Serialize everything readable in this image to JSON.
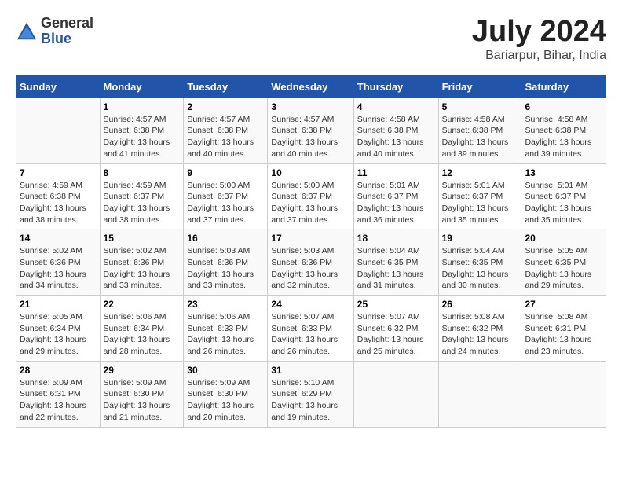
{
  "header": {
    "logo_general": "General",
    "logo_blue": "Blue",
    "title": "July 2024",
    "subtitle": "Bariarpur, Bihar, India"
  },
  "days_of_week": [
    "Sunday",
    "Monday",
    "Tuesday",
    "Wednesday",
    "Thursday",
    "Friday",
    "Saturday"
  ],
  "weeks": [
    [
      {
        "day": "",
        "info": ""
      },
      {
        "day": "1",
        "info": "Sunrise: 4:57 AM\nSunset: 6:38 PM\nDaylight: 13 hours\nand 41 minutes."
      },
      {
        "day": "2",
        "info": "Sunrise: 4:57 AM\nSunset: 6:38 PM\nDaylight: 13 hours\nand 40 minutes."
      },
      {
        "day": "3",
        "info": "Sunrise: 4:57 AM\nSunset: 6:38 PM\nDaylight: 13 hours\nand 40 minutes."
      },
      {
        "day": "4",
        "info": "Sunrise: 4:58 AM\nSunset: 6:38 PM\nDaylight: 13 hours\nand 40 minutes."
      },
      {
        "day": "5",
        "info": "Sunrise: 4:58 AM\nSunset: 6:38 PM\nDaylight: 13 hours\nand 39 minutes."
      },
      {
        "day": "6",
        "info": "Sunrise: 4:58 AM\nSunset: 6:38 PM\nDaylight: 13 hours\nand 39 minutes."
      }
    ],
    [
      {
        "day": "7",
        "info": "Sunrise: 4:59 AM\nSunset: 6:38 PM\nDaylight: 13 hours\nand 38 minutes."
      },
      {
        "day": "8",
        "info": "Sunrise: 4:59 AM\nSunset: 6:37 PM\nDaylight: 13 hours\nand 38 minutes."
      },
      {
        "day": "9",
        "info": "Sunrise: 5:00 AM\nSunset: 6:37 PM\nDaylight: 13 hours\nand 37 minutes."
      },
      {
        "day": "10",
        "info": "Sunrise: 5:00 AM\nSunset: 6:37 PM\nDaylight: 13 hours\nand 37 minutes."
      },
      {
        "day": "11",
        "info": "Sunrise: 5:01 AM\nSunset: 6:37 PM\nDaylight: 13 hours\nand 36 minutes."
      },
      {
        "day": "12",
        "info": "Sunrise: 5:01 AM\nSunset: 6:37 PM\nDaylight: 13 hours\nand 35 minutes."
      },
      {
        "day": "13",
        "info": "Sunrise: 5:01 AM\nSunset: 6:37 PM\nDaylight: 13 hours\nand 35 minutes."
      }
    ],
    [
      {
        "day": "14",
        "info": "Sunrise: 5:02 AM\nSunset: 6:36 PM\nDaylight: 13 hours\nand 34 minutes."
      },
      {
        "day": "15",
        "info": "Sunrise: 5:02 AM\nSunset: 6:36 PM\nDaylight: 13 hours\nand 33 minutes."
      },
      {
        "day": "16",
        "info": "Sunrise: 5:03 AM\nSunset: 6:36 PM\nDaylight: 13 hours\nand 33 minutes."
      },
      {
        "day": "17",
        "info": "Sunrise: 5:03 AM\nSunset: 6:36 PM\nDaylight: 13 hours\nand 32 minutes."
      },
      {
        "day": "18",
        "info": "Sunrise: 5:04 AM\nSunset: 6:35 PM\nDaylight: 13 hours\nand 31 minutes."
      },
      {
        "day": "19",
        "info": "Sunrise: 5:04 AM\nSunset: 6:35 PM\nDaylight: 13 hours\nand 30 minutes."
      },
      {
        "day": "20",
        "info": "Sunrise: 5:05 AM\nSunset: 6:35 PM\nDaylight: 13 hours\nand 29 minutes."
      }
    ],
    [
      {
        "day": "21",
        "info": "Sunrise: 5:05 AM\nSunset: 6:34 PM\nDaylight: 13 hours\nand 29 minutes."
      },
      {
        "day": "22",
        "info": "Sunrise: 5:06 AM\nSunset: 6:34 PM\nDaylight: 13 hours\nand 28 minutes."
      },
      {
        "day": "23",
        "info": "Sunrise: 5:06 AM\nSunset: 6:33 PM\nDaylight: 13 hours\nand 26 minutes."
      },
      {
        "day": "24",
        "info": "Sunrise: 5:07 AM\nSunset: 6:33 PM\nDaylight: 13 hours\nand 26 minutes."
      },
      {
        "day": "25",
        "info": "Sunrise: 5:07 AM\nSunset: 6:32 PM\nDaylight: 13 hours\nand 25 minutes."
      },
      {
        "day": "26",
        "info": "Sunrise: 5:08 AM\nSunset: 6:32 PM\nDaylight: 13 hours\nand 24 minutes."
      },
      {
        "day": "27",
        "info": "Sunrise: 5:08 AM\nSunset: 6:31 PM\nDaylight: 13 hours\nand 23 minutes."
      }
    ],
    [
      {
        "day": "28",
        "info": "Sunrise: 5:09 AM\nSunset: 6:31 PM\nDaylight: 13 hours\nand 22 minutes."
      },
      {
        "day": "29",
        "info": "Sunrise: 5:09 AM\nSunset: 6:30 PM\nDaylight: 13 hours\nand 21 minutes."
      },
      {
        "day": "30",
        "info": "Sunrise: 5:09 AM\nSunset: 6:30 PM\nDaylight: 13 hours\nand 20 minutes."
      },
      {
        "day": "31",
        "info": "Sunrise: 5:10 AM\nSunset: 6:29 PM\nDaylight: 13 hours\nand 19 minutes."
      },
      {
        "day": "",
        "info": ""
      },
      {
        "day": "",
        "info": ""
      },
      {
        "day": "",
        "info": ""
      }
    ]
  ]
}
